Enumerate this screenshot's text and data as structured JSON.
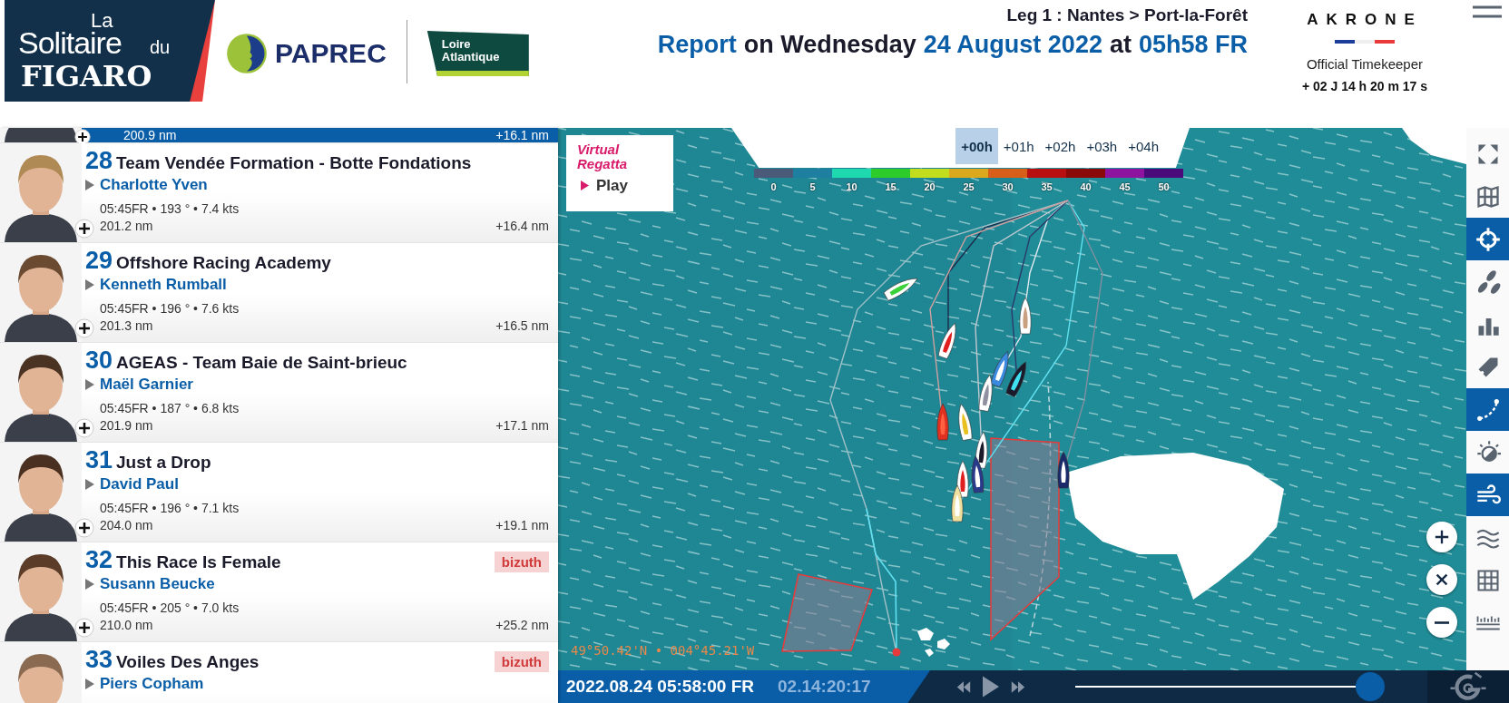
{
  "header": {
    "logo_words": [
      "La",
      "Solitaire",
      "du",
      "FIGARO"
    ],
    "sponsors": [
      "PAPREC",
      "Loire Atlantique"
    ],
    "leg": "Leg 1 : Nantes > Port-la-Forêt",
    "report": [
      {
        "text": "Report",
        "accent": true
      },
      {
        "text": "on Wednesday",
        "accent": false
      },
      {
        "text": "24 August 2022",
        "accent": true
      },
      {
        "text": "at",
        "accent": false
      },
      {
        "text": "05h58 FR",
        "accent": true
      }
    ],
    "timekeeper": {
      "brand": "AKRONE",
      "label": "Official Timekeeper",
      "elapsed": "+ 02 J 14 h 20 m 17 s"
    }
  },
  "ranking": [
    {
      "partial": true,
      "selected": true,
      "distance": "200.9 nm",
      "gap": "+16.1 nm"
    },
    {
      "partial": false,
      "selected": false,
      "rank": "28",
      "team": "Team Vendée Formation - Botte Fondations",
      "skipper": "Charlotte Yven",
      "info": "05:45FR • 193 ° • 7.4 kts",
      "distance": "201.2 nm",
      "gap": "+16.4 nm"
    },
    {
      "partial": false,
      "selected": false,
      "rank": "29",
      "team": "Offshore Racing Academy",
      "skipper": "Kenneth Rumball",
      "info": "05:45FR • 196 ° • 7.6 kts",
      "distance": "201.3 nm",
      "gap": "+16.5 nm"
    },
    {
      "partial": false,
      "selected": false,
      "rank": "30",
      "team": "AGEAS - Team Baie de Saint-brieuc",
      "skipper": "Maël Garnier",
      "info": "05:45FR • 187 ° • 6.8 kts",
      "distance": "201.9 nm",
      "gap": "+17.1 nm"
    },
    {
      "partial": false,
      "selected": false,
      "rank": "31",
      "team": "Just a Drop",
      "skipper": "David Paul",
      "info": "05:45FR • 196 ° • 7.1 kts",
      "distance": "204.0 nm",
      "gap": "+19.1 nm"
    },
    {
      "partial": false,
      "selected": false,
      "rank": "32",
      "team": "This Race Is Female",
      "skipper": "Susann Beucke",
      "info": "05:45FR • 205 ° • 7.0 kts",
      "distance": "210.0 nm",
      "gap": "+25.2 nm",
      "badge": "bizuth"
    },
    {
      "partial": false,
      "selected": false,
      "rank": "33",
      "team": "Voiles Des Anges",
      "skipper": "Piers Copham",
      "badge": "bizuth"
    }
  ],
  "map": {
    "game": {
      "name": "Virtual Regatta",
      "action": "Play"
    },
    "forecast_tabs": [
      {
        "label": "+00h",
        "selected": true
      },
      {
        "label": "+01h",
        "selected": false
      },
      {
        "label": "+02h",
        "selected": false
      },
      {
        "label": "+03h",
        "selected": false
      },
      {
        "label": "+04h",
        "selected": false
      }
    ],
    "wind_scale": [
      {
        "label": "0",
        "color": "#4a5a78"
      },
      {
        "label": "5",
        "color": "#1e7fa0"
      },
      {
        "label": "10",
        "color": "#1fd8b0"
      },
      {
        "label": "15",
        "color": "#2ecc2a"
      },
      {
        "label": "20",
        "color": "#c2dc1e"
      },
      {
        "label": "25",
        "color": "#dca81e"
      },
      {
        "label": "30",
        "color": "#d85f1a"
      },
      {
        "label": "35",
        "color": "#b81010"
      },
      {
        "label": "40",
        "color": "#8a0a0a"
      },
      {
        "label": "45",
        "color": "#8e14a0"
      },
      {
        "label": "50",
        "color": "#4a0a7a"
      }
    ],
    "coordinates": "49°50.42'N • 004°45.21'W"
  },
  "toolbar": [
    {
      "selected": false
    },
    {
      "selected": false
    },
    {
      "selected": true
    },
    {
      "selected": false
    },
    {
      "selected": false
    },
    {
      "selected": false
    },
    {
      "selected": true
    },
    {
      "selected": false
    },
    {
      "selected": true
    },
    {
      "selected": false
    },
    {
      "selected": false
    },
    {
      "selected": false
    }
  ],
  "playback": {
    "date": "2022.08.24 05:58:00 FR",
    "elapsed": "02.14:20:17",
    "level": 0.98
  }
}
